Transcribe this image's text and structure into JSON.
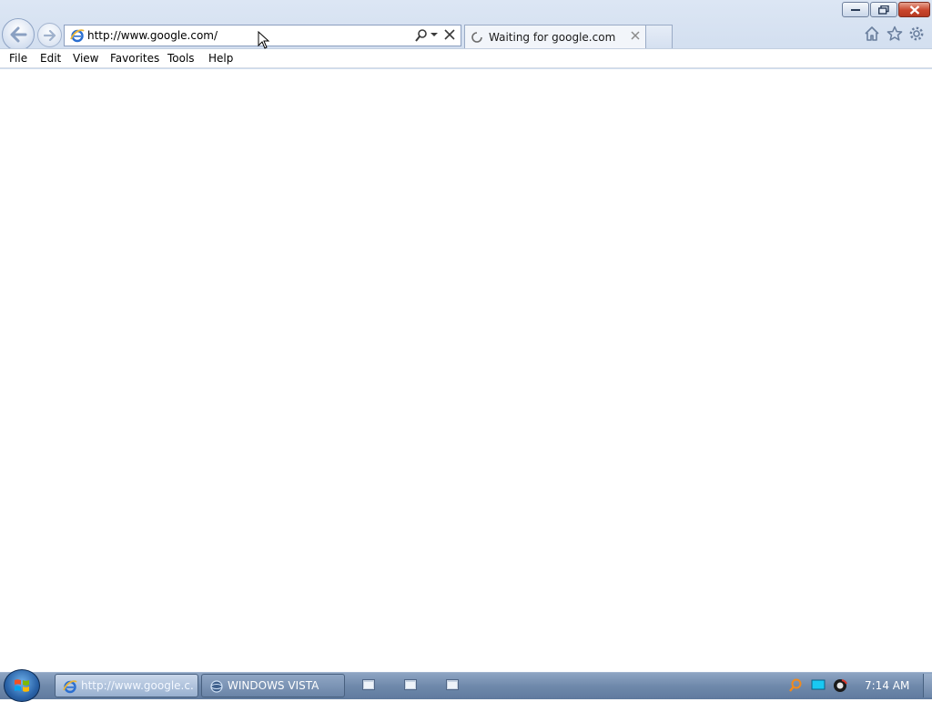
{
  "browser": {
    "address_url": "http://www.google.com/",
    "tab_title": "Waiting for google.com"
  },
  "menu": [
    "File",
    "Edit",
    "View",
    "Favorites",
    "Tools",
    "Help"
  ],
  "taskbar": {
    "active_window_label": "http://www.google.c...",
    "second_window_label": "WINDOWS VISTA",
    "clock": "7:14 AM"
  },
  "colors": {
    "frame": "#d4dfef",
    "taskbar": "#6f89ab",
    "close_button": "#c8452c"
  },
  "icons": {
    "back": "back-arrow-icon",
    "forward": "forward-arrow-icon",
    "home": "home-icon",
    "favorites": "star-icon",
    "tools": "gear-icon",
    "loading": "spinner-icon"
  }
}
